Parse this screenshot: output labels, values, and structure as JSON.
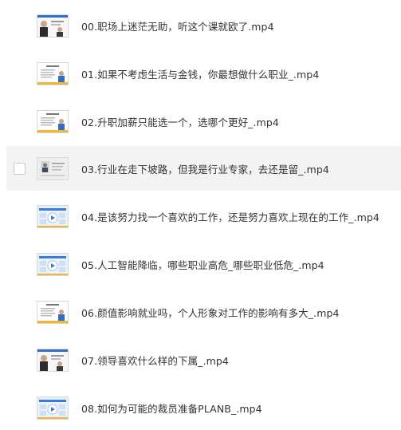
{
  "files": [
    {
      "name": "00.职场上迷茫无助，听这个课就欧了.mp4",
      "thumb": "person-slide-thumbnail"
    },
    {
      "name": "01.如果不考虑生活与金钱，你最想做什么职业_.mp4",
      "thumb": "teacher-slide-thumbnail"
    },
    {
      "name": "02.升职加薪只能选一个，选哪个更好_.mp4",
      "thumb": "teacher-slide-thumbnail"
    },
    {
      "name": "03.行业在走下坡路，但我是行业专家，去还是留_.mp4",
      "thumb": "portrait-slide-thumbnail",
      "hovered": true
    },
    {
      "name": "04.是该努力找一个喜欢的工作，还是努力喜欢上现在的工作_.mp4",
      "thumb": "video-play-thumbnail"
    },
    {
      "name": "05.人工智能降临，哪些职业高危_哪些职业低危_.mp4",
      "thumb": "video-play-thumbnail"
    },
    {
      "name": "06.颜值影响就业吗，个人形象对工作的影响有多大_.mp4",
      "thumb": "teacher-slide-thumbnail"
    },
    {
      "name": "07.领导喜欢什么样的下属_.mp4",
      "thumb": "person-slide-thumbnail"
    },
    {
      "name": "08.如何为可能的裁员准备PLANB_.mp4",
      "thumb": "video-play-thumbnail"
    }
  ],
  "colors": {
    "hover_bg": "#f3f3f3",
    "text": "#333333",
    "slide_blue": "#3a7bd5",
    "slide_yellow": "#f2b632"
  }
}
